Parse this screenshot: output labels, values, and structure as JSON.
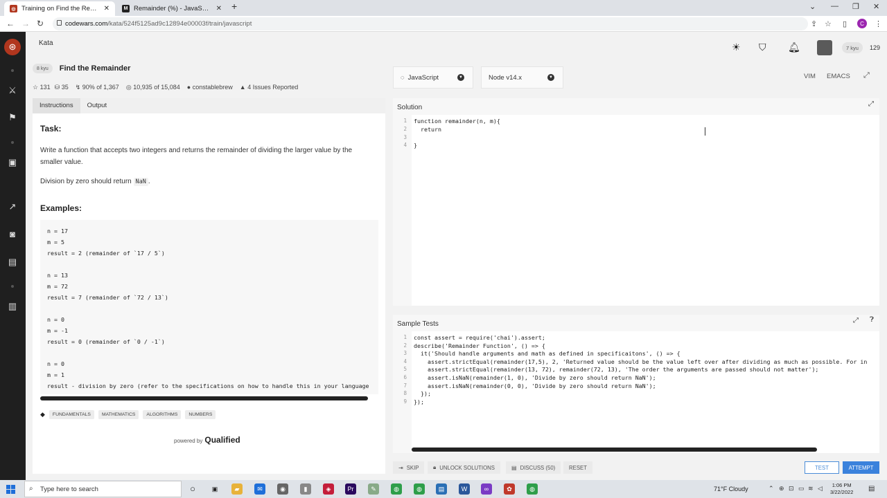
{
  "browser": {
    "tabs": [
      {
        "title": "Training on Find the Remainder |",
        "active": true
      },
      {
        "title": "Remainder (%) - JavaScript | MD",
        "active": false
      }
    ],
    "url_host": "codewars.com",
    "url_path": "/kata/524f5125ad9c12894e00003f/train/javascript",
    "profile_letter": "C"
  },
  "nav": {
    "section": "Kata",
    "rank": "7 kyu",
    "honor": "129"
  },
  "kata": {
    "rank": "8 kyu",
    "name": "Find the Remainder",
    "stars": "131",
    "collections": "35",
    "satisfaction": "90% of 1,367",
    "completed": "10,935 of 15,084",
    "author": "constablebrew",
    "issues": "4 Issues Reported"
  },
  "left": {
    "tab_instructions": "Instructions",
    "tab_output": "Output",
    "task_heading": "Task:",
    "task_text": "Write a function that accepts two integers and returns the remainder of dividing the larger value by the smaller value.",
    "divzero_pre": "Division by zero should return ",
    "divzero_code": "NaN",
    "divzero_post": ".",
    "examples_heading": "Examples:",
    "example_lines": [
      "n = 17",
      "m = 5",
      "result = 2 (remainder of `17 / 5`)",
      "",
      "n = 13",
      "m = 72",
      "result = 7 (remainder of `72 / 13`)",
      "",
      "n = 0",
      "m = -1",
      "result = 0 (remainder of `0 / -1`)",
      "",
      "n = 0",
      "m = 1",
      "result - division by zero (refer to the specifications on how to handle this in your language"
    ],
    "tags": [
      "FUNDAMENTALS",
      "MATHEMATICS",
      "ALGORITHMS",
      "NUMBERS"
    ],
    "powered_by": "powered by",
    "brand": "Qualified"
  },
  "editor": {
    "language": "JavaScript",
    "runtime": "Node v14.x",
    "mode_vim": "VIM",
    "mode_emacs": "EMACS",
    "solution_title": "Solution",
    "solution_lines": [
      "function remainder(n, m){",
      "  return ",
      "",
      "}"
    ],
    "tests_title": "Sample Tests",
    "test_lines": [
      "const assert = require('chai').assert;",
      "describe('Remainder Function', () => {",
      "  it('Should handle arguments and math as defined in specificaitons', () => {",
      "    assert.strictEqual(remainder(17,5), 2, 'Returned value should be the value left over after dividing as much as possible. For in",
      "    assert.strictEqual(remainder(13, 72), remainder(72, 13), 'The order the arguments are passed should not matter');",
      "    assert.isNaN(remainder(1, 0), 'Divide by zero should return NaN');",
      "    assert.isNaN(remainder(0, 0), 'Divide by zero should return NaN');",
      "  });",
      "});"
    ]
  },
  "actions": {
    "skip": "SKIP",
    "unlock": "UNLOCK SOLUTIONS",
    "discuss": "DISCUSS (50)",
    "reset": "RESET",
    "test": "TEST",
    "attempt": "ATTEMPT"
  },
  "taskbar": {
    "search_placeholder": "Type here to search",
    "weather": "71°F  Cloudy",
    "time": "1:06 PM",
    "date": "3/22/2022"
  }
}
